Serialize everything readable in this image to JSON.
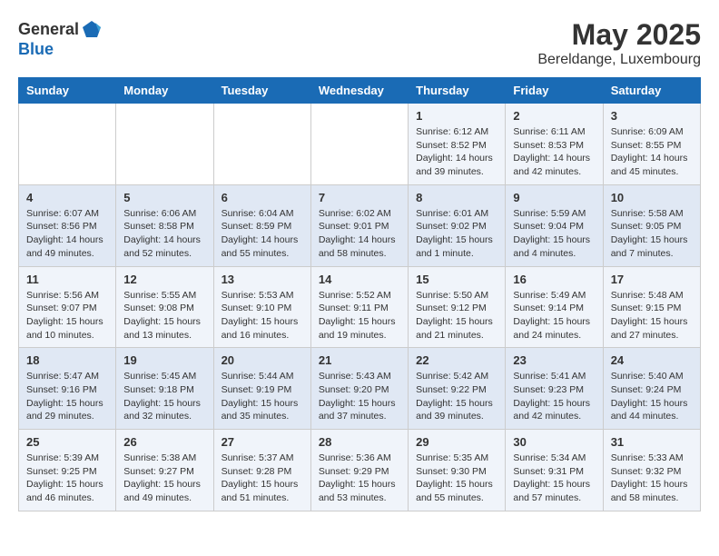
{
  "header": {
    "logo_general": "General",
    "logo_blue": "Blue",
    "month": "May 2025",
    "location": "Bereldange, Luxembourg"
  },
  "days_of_week": [
    "Sunday",
    "Monday",
    "Tuesday",
    "Wednesday",
    "Thursday",
    "Friday",
    "Saturday"
  ],
  "weeks": [
    [
      {
        "day": "",
        "info": ""
      },
      {
        "day": "",
        "info": ""
      },
      {
        "day": "",
        "info": ""
      },
      {
        "day": "",
        "info": ""
      },
      {
        "day": "1",
        "info": "Sunrise: 6:12 AM\nSunset: 8:52 PM\nDaylight: 14 hours\nand 39 minutes."
      },
      {
        "day": "2",
        "info": "Sunrise: 6:11 AM\nSunset: 8:53 PM\nDaylight: 14 hours\nand 42 minutes."
      },
      {
        "day": "3",
        "info": "Sunrise: 6:09 AM\nSunset: 8:55 PM\nDaylight: 14 hours\nand 45 minutes."
      }
    ],
    [
      {
        "day": "4",
        "info": "Sunrise: 6:07 AM\nSunset: 8:56 PM\nDaylight: 14 hours\nand 49 minutes."
      },
      {
        "day": "5",
        "info": "Sunrise: 6:06 AM\nSunset: 8:58 PM\nDaylight: 14 hours\nand 52 minutes."
      },
      {
        "day": "6",
        "info": "Sunrise: 6:04 AM\nSunset: 8:59 PM\nDaylight: 14 hours\nand 55 minutes."
      },
      {
        "day": "7",
        "info": "Sunrise: 6:02 AM\nSunset: 9:01 PM\nDaylight: 14 hours\nand 58 minutes."
      },
      {
        "day": "8",
        "info": "Sunrise: 6:01 AM\nSunset: 9:02 PM\nDaylight: 15 hours\nand 1 minute."
      },
      {
        "day": "9",
        "info": "Sunrise: 5:59 AM\nSunset: 9:04 PM\nDaylight: 15 hours\nand 4 minutes."
      },
      {
        "day": "10",
        "info": "Sunrise: 5:58 AM\nSunset: 9:05 PM\nDaylight: 15 hours\nand 7 minutes."
      }
    ],
    [
      {
        "day": "11",
        "info": "Sunrise: 5:56 AM\nSunset: 9:07 PM\nDaylight: 15 hours\nand 10 minutes."
      },
      {
        "day": "12",
        "info": "Sunrise: 5:55 AM\nSunset: 9:08 PM\nDaylight: 15 hours\nand 13 minutes."
      },
      {
        "day": "13",
        "info": "Sunrise: 5:53 AM\nSunset: 9:10 PM\nDaylight: 15 hours\nand 16 minutes."
      },
      {
        "day": "14",
        "info": "Sunrise: 5:52 AM\nSunset: 9:11 PM\nDaylight: 15 hours\nand 19 minutes."
      },
      {
        "day": "15",
        "info": "Sunrise: 5:50 AM\nSunset: 9:12 PM\nDaylight: 15 hours\nand 21 minutes."
      },
      {
        "day": "16",
        "info": "Sunrise: 5:49 AM\nSunset: 9:14 PM\nDaylight: 15 hours\nand 24 minutes."
      },
      {
        "day": "17",
        "info": "Sunrise: 5:48 AM\nSunset: 9:15 PM\nDaylight: 15 hours\nand 27 minutes."
      }
    ],
    [
      {
        "day": "18",
        "info": "Sunrise: 5:47 AM\nSunset: 9:16 PM\nDaylight: 15 hours\nand 29 minutes."
      },
      {
        "day": "19",
        "info": "Sunrise: 5:45 AM\nSunset: 9:18 PM\nDaylight: 15 hours\nand 32 minutes."
      },
      {
        "day": "20",
        "info": "Sunrise: 5:44 AM\nSunset: 9:19 PM\nDaylight: 15 hours\nand 35 minutes."
      },
      {
        "day": "21",
        "info": "Sunrise: 5:43 AM\nSunset: 9:20 PM\nDaylight: 15 hours\nand 37 minutes."
      },
      {
        "day": "22",
        "info": "Sunrise: 5:42 AM\nSunset: 9:22 PM\nDaylight: 15 hours\nand 39 minutes."
      },
      {
        "day": "23",
        "info": "Sunrise: 5:41 AM\nSunset: 9:23 PM\nDaylight: 15 hours\nand 42 minutes."
      },
      {
        "day": "24",
        "info": "Sunrise: 5:40 AM\nSunset: 9:24 PM\nDaylight: 15 hours\nand 44 minutes."
      }
    ],
    [
      {
        "day": "25",
        "info": "Sunrise: 5:39 AM\nSunset: 9:25 PM\nDaylight: 15 hours\nand 46 minutes."
      },
      {
        "day": "26",
        "info": "Sunrise: 5:38 AM\nSunset: 9:27 PM\nDaylight: 15 hours\nand 49 minutes."
      },
      {
        "day": "27",
        "info": "Sunrise: 5:37 AM\nSunset: 9:28 PM\nDaylight: 15 hours\nand 51 minutes."
      },
      {
        "day": "28",
        "info": "Sunrise: 5:36 AM\nSunset: 9:29 PM\nDaylight: 15 hours\nand 53 minutes."
      },
      {
        "day": "29",
        "info": "Sunrise: 5:35 AM\nSunset: 9:30 PM\nDaylight: 15 hours\nand 55 minutes."
      },
      {
        "day": "30",
        "info": "Sunrise: 5:34 AM\nSunset: 9:31 PM\nDaylight: 15 hours\nand 57 minutes."
      },
      {
        "day": "31",
        "info": "Sunrise: 5:33 AM\nSunset: 9:32 PM\nDaylight: 15 hours\nand 58 minutes."
      }
    ]
  ]
}
